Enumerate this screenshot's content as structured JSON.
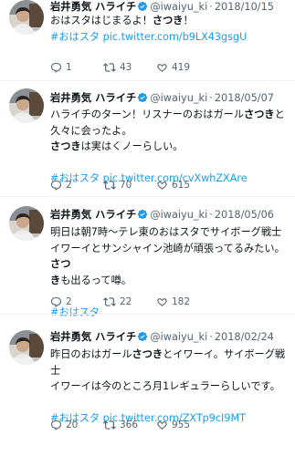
{
  "tweets": [
    {
      "name": "岩井勇気 ハライチ",
      "handle": "@iwaiyu_ki",
      "dot": "·",
      "date": "2018/10/15",
      "body": [
        [
          {
            "t": "おはスタはじまるよ！"
          },
          {
            "t": "さつき",
            "b": true
          },
          {
            "t": "！"
          }
        ],
        [
          {
            "t": "#おはスタ pic.twitter.com/b9LX43gsgU",
            "l": true
          }
        ]
      ],
      "replies": "1",
      "retweets": "43",
      "likes": "419"
    },
    {
      "name": "岩井勇気 ハライチ",
      "handle": "@iwaiyu_ki",
      "dot": "·",
      "date": "2018/05/07",
      "body": [
        [
          {
            "t": "ハライチのターン！リスナーのおはガール"
          },
          {
            "t": "さつき",
            "b": true
          },
          {
            "t": "と"
          }
        ],
        [
          {
            "t": "久々に会ったよ。"
          }
        ],
        [
          {
            "t": "さつき",
            "b": true
          },
          {
            "t": "は実はくノーらしい。"
          }
        ],
        [
          {
            "t": ""
          }
        ],
        [
          {
            "t": "#おはスタ pic.twitter.com/cvXwhZXAre",
            "l": true
          }
        ]
      ],
      "replies": "2",
      "retweets": "70",
      "likes": "615"
    },
    {
      "name": "岩井勇気 ハライチ",
      "handle": "@iwaiyu_ki",
      "dot": "·",
      "date": "2018/05/06",
      "body": [
        [
          {
            "t": "明日は朝7時〜テレ東のおはスタでサイボーグ戦士"
          }
        ],
        [
          {
            "t": "イワーイとサンシャイン池崎が頑張ってるみたい。"
          },
          {
            "t": "さつ",
            "b": true
          }
        ],
        [
          {
            "t": "き",
            "b": true
          },
          {
            "t": "も出るって噂。"
          }
        ],
        [
          {
            "t": ""
          }
        ],
        [
          {
            "t": "#おはスタ",
            "l": true
          }
        ]
      ],
      "replies": "2",
      "retweets": "22",
      "likes": "182"
    },
    {
      "name": "岩井勇気 ハライチ",
      "handle": "@iwaiyu_ki",
      "dot": "·",
      "date": "2018/02/24",
      "body": [
        [
          {
            "t": "昨日のおはガール"
          },
          {
            "t": "さつき",
            "b": true
          },
          {
            "t": "とイワーイ。サイボーグ戦士"
          }
        ],
        [
          {
            "t": "イワーイは今のところ月1レギュラーらしいです。"
          }
        ],
        [
          {
            "t": ""
          }
        ],
        [
          {
            "t": "#おはスタ pic.twitter.com/ZXTp9cI9MT",
            "l": true
          }
        ]
      ],
      "replies": "20",
      "retweets": "366",
      "likes": "955"
    }
  ],
  "colors": {
    "link": "#1d9bf0",
    "meta": "#536471",
    "verified": "#1d9bf0"
  },
  "icons": {
    "verified": "verified-badge-icon",
    "reply": "reply-icon",
    "retweet": "retweet-icon",
    "like": "like-icon",
    "avatar": "profile-photo"
  }
}
